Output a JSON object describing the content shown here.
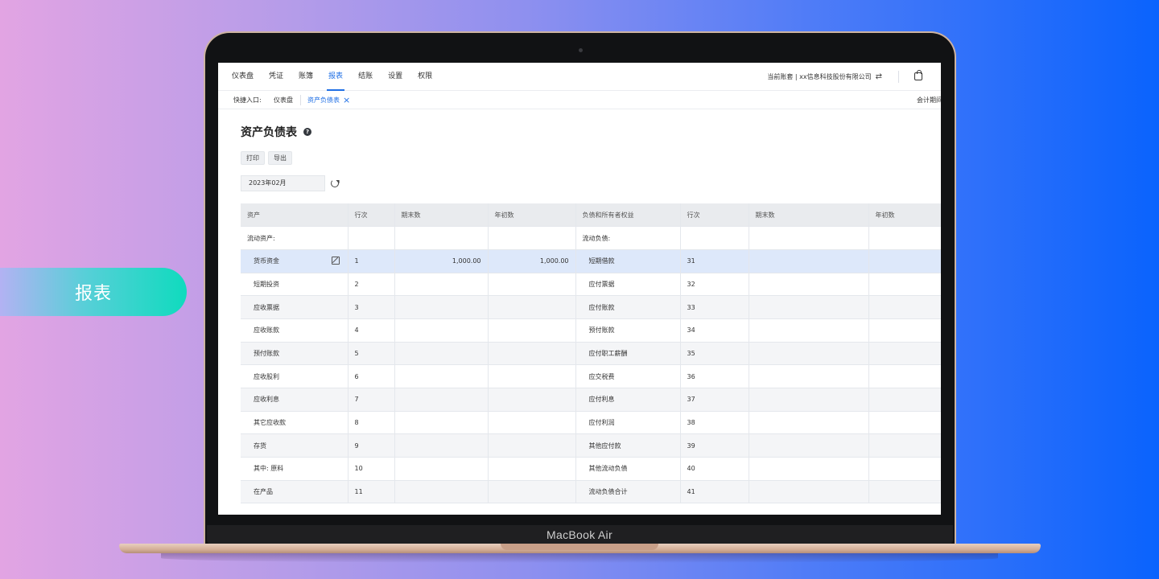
{
  "side_tag": {
    "label": "报表"
  },
  "device": {
    "brand": "MacBook Air"
  },
  "app": {
    "nav": [
      {
        "label": "仪表盘",
        "active": false
      },
      {
        "label": "凭证",
        "active": false
      },
      {
        "label": "账簿",
        "active": false
      },
      {
        "label": "报表",
        "active": true
      },
      {
        "label": "结账",
        "active": false
      },
      {
        "label": "设置",
        "active": false
      },
      {
        "label": "权限",
        "active": false
      }
    ],
    "company": "当前账套 | xx信息科技股份有限公司",
    "quickbar": {
      "label": "快捷入口:",
      "tabs": [
        "仪表盘",
        "资产负债表"
      ],
      "right_text": "会计期间"
    },
    "page_title": "资产负债表",
    "buttons": {
      "print": "打印",
      "export": "导出"
    },
    "period": "2023年02月",
    "table": {
      "headers": [
        "资产",
        "行次",
        "期末数",
        "年初数",
        "负债和所有者权益",
        "行次",
        "期末数",
        "年初数"
      ],
      "rows": [
        [
          "流动资产:",
          "",
          "",
          "",
          "流动负债:",
          "",
          "",
          ""
        ],
        [
          "货币资金",
          "1",
          "1,000.00",
          "1,000.00",
          "短期借款",
          "31",
          "",
          ""
        ],
        [
          "短期投资",
          "2",
          "",
          "",
          "应付票据",
          "32",
          "",
          ""
        ],
        [
          "应收票据",
          "3",
          "",
          "",
          "应付账款",
          "33",
          "",
          ""
        ],
        [
          "应收账款",
          "4",
          "",
          "",
          "预付账款",
          "34",
          "",
          ""
        ],
        [
          "预付账款",
          "5",
          "",
          "",
          "应付职工薪酬",
          "35",
          "",
          ""
        ],
        [
          "应收股利",
          "6",
          "",
          "",
          "应交税费",
          "36",
          "",
          ""
        ],
        [
          "应收利息",
          "7",
          "",
          "",
          "应付利息",
          "37",
          "",
          ""
        ],
        [
          "其它应收款",
          "8",
          "",
          "",
          "应付利润",
          "38",
          "",
          ""
        ],
        [
          "存货",
          "9",
          "",
          "",
          "其他应付款",
          "39",
          "",
          ""
        ],
        [
          "其中: 原料",
          "10",
          "",
          "",
          "其他流动负债",
          "40",
          "",
          ""
        ],
        [
          "在产品",
          "11",
          "",
          "",
          "流动负债合计",
          "41",
          "",
          ""
        ]
      ]
    }
  },
  "colors": {
    "accent": "#1f6fe5",
    "selected_row": "#dde8fa",
    "tag_gradient_end": "#0fdbbe",
    "bg_gradient_end": "#0a63fd"
  }
}
